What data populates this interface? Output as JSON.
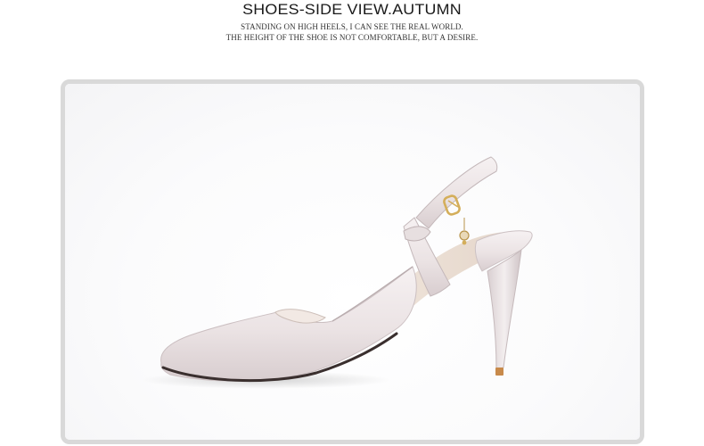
{
  "header": {
    "title": "SHOES-SIDE VIEW.AUTUMN",
    "subtitle_line1": "STANDING ON HIGH HEELS, I CAN SEE THE REAL WORLD.",
    "subtitle_line2": "THE HEIGHT OF THE SHOE IS NOT COMFORTABLE, BUT A DESIRE."
  },
  "photo": {
    "subject": "pointed-toe-slingback-high-heel-pump",
    "colors": {
      "leather": "#ece5e6",
      "leather_shadow": "#c9bfc1",
      "insole": "#e9dcd2",
      "sole_edge": "#3a2f2e",
      "heel_tip": "#c88a4a",
      "buckle": "#d4ae5a",
      "frame": "#d9d9d9"
    }
  }
}
